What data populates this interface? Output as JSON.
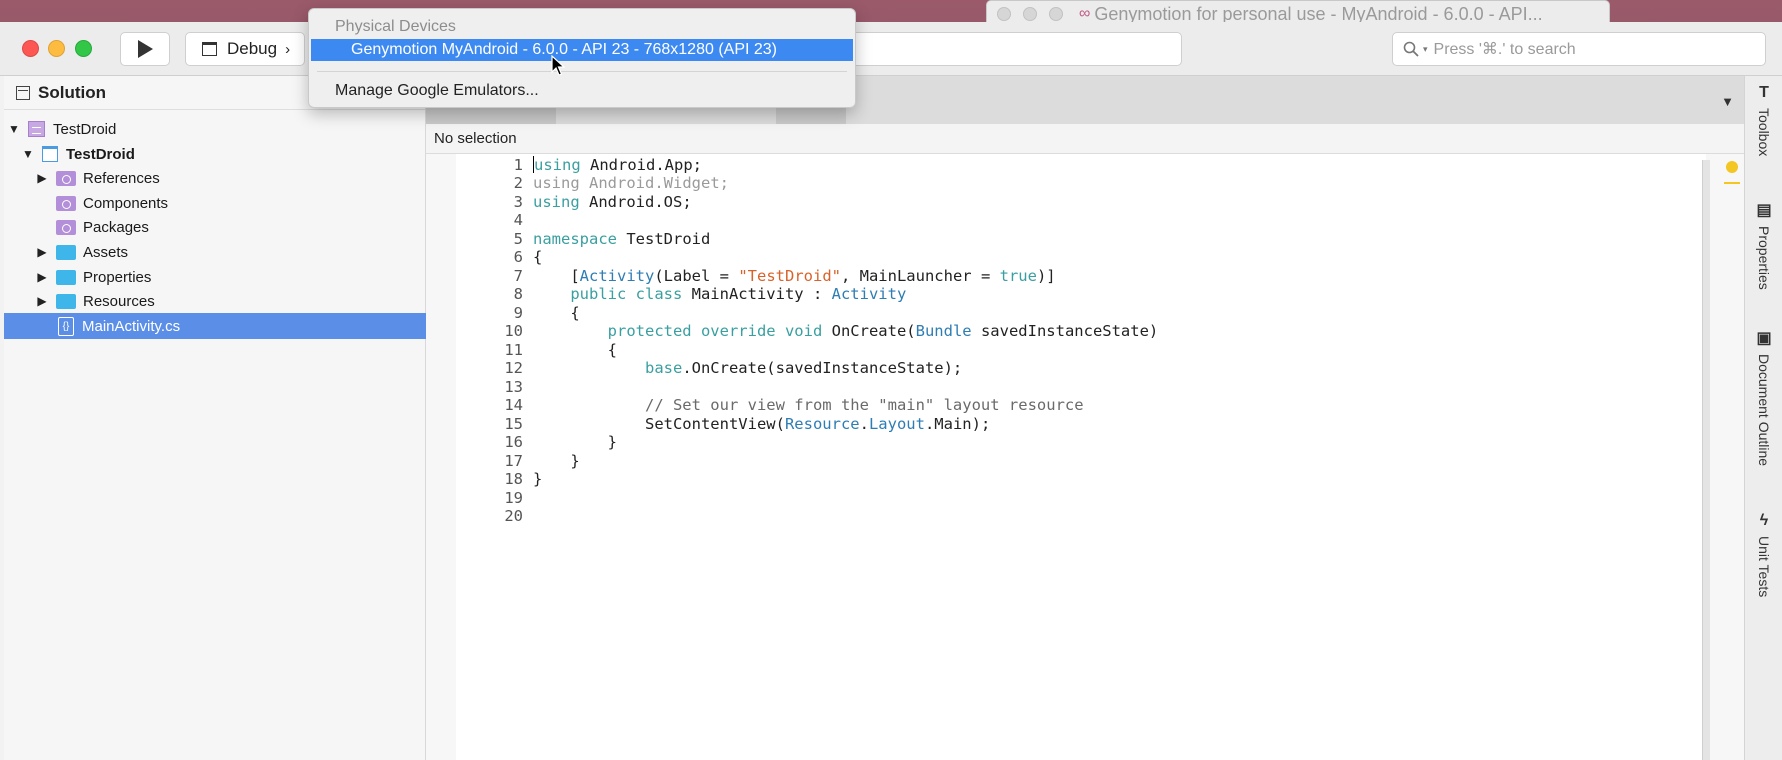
{
  "background_window": {
    "title": "Genymotion for personal use - MyAndroid - 6.0.0 - API..."
  },
  "toolbar": {
    "config_label": "Debug",
    "config_chevron": "›",
    "search_placeholder": "Press '⌘.' to search"
  },
  "device_menu": {
    "heading": "Physical Devices",
    "selected_item": "Genymotion MyAndroid - 6.0.0 - API 23 - 768x1280 (API 23)",
    "manage_item": "Manage Google Emulators..."
  },
  "sidebar": {
    "title": "Solution",
    "tree": [
      {
        "label": "TestDroid",
        "kind": "solution",
        "expanded": true
      },
      {
        "label": "TestDroid",
        "kind": "project",
        "expanded": true
      },
      {
        "label": "References",
        "kind": "purple-folder",
        "expandable": true
      },
      {
        "label": "Components",
        "kind": "purple-folder",
        "expandable": false
      },
      {
        "label": "Packages",
        "kind": "purple-folder",
        "expandable": false
      },
      {
        "label": "Assets",
        "kind": "blue-folder",
        "expandable": true
      },
      {
        "label": "Properties",
        "kind": "blue-folder",
        "expandable": true
      },
      {
        "label": "Resources",
        "kind": "blue-folder",
        "expandable": true
      },
      {
        "label": "MainActivity.cs",
        "kind": "cs-file",
        "selected": true
      }
    ]
  },
  "editor": {
    "nav_text": "No selection",
    "line_numbers": [
      "1",
      "2",
      "3",
      "4",
      "5",
      "6",
      "7",
      "8",
      "9",
      "10",
      "11",
      "12",
      "13",
      "14",
      "15",
      "16",
      "17",
      "18",
      "19",
      "20"
    ],
    "code": {
      "l1_kw": "using",
      "l1_rest": " Android.App;",
      "l2_kw": "using",
      "l2_rest": " Android.Widget;",
      "l3_kw": "using",
      "l3_rest": " Android.OS;",
      "l5_kw": "namespace",
      "l5_rest": " TestDroid",
      "l6": "{",
      "l7_a": "    [",
      "l7_type": "Activity",
      "l7_b": "(Label = ",
      "l7_str": "\"TestDroid\"",
      "l7_c": ", MainLauncher = ",
      "l7_true": "true",
      "l7_d": ")]",
      "l8_indent": "    ",
      "l8_kw": "public class",
      "l8_name": " MainActivity : ",
      "l8_base": "Activity",
      "l9": "    {",
      "l10_indent": "        ",
      "l10_kw": "protected override void",
      "l10_name": " OnCreate(",
      "l10_type": "Bundle",
      "l10_rest": " savedInstanceState)",
      "l11": "        {",
      "l12_indent": "            ",
      "l12_kw": "base",
      "l12_rest": ".OnCreate(savedInstanceState);",
      "l14": "            // Set our view from the \"main\" layout resource",
      "l15_a": "            SetContentView(",
      "l15_t1": "Resource",
      "l15_dot": ".",
      "l15_t2": "Layout",
      "l15_rest": ".Main);",
      "l16": "        }",
      "l17": "    }",
      "l18": "}"
    }
  },
  "right_pads": {
    "toolbox": "Toolbox",
    "properties": "Properties",
    "document_outline": "Document Outline",
    "unit_tests": "Unit Tests"
  }
}
